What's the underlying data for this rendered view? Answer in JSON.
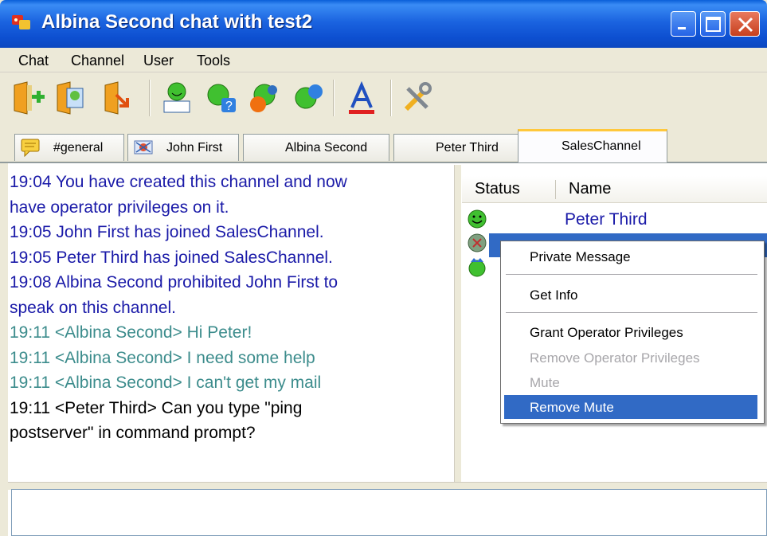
{
  "window": {
    "title": "Albina Second chat with test2",
    "title_color": "#ffffff",
    "titlebar_color": "#0d4fd0"
  },
  "menu": {
    "items": [
      "Chat",
      "Channel",
      "User",
      "Tools"
    ]
  },
  "toolbar": {
    "icons": [
      "enter-channel-icon",
      "channel-list-icon",
      "leave-channel-icon",
      "private-message-icon",
      "user-info-icon",
      "send-file-icon",
      "add-contact-icon",
      "font-icon",
      "settings-icon"
    ]
  },
  "tabs": [
    {
      "label": "#general",
      "icon": "chat-bubble-icon"
    },
    {
      "label": "John First",
      "icon": "muted-user-icon"
    },
    {
      "label": "Albina Second"
    },
    {
      "label": "Peter Third"
    },
    {
      "label": "SalesChannel",
      "active": true
    }
  ],
  "chat": {
    "lines": [
      {
        "text": "19:04 You have created this channel and now",
        "color": "blue"
      },
      {
        "text": "have operator privileges on it.",
        "color": "blue"
      },
      {
        "text": "19:05 John First has joined SalesChannel.",
        "color": "blue"
      },
      {
        "text": "19:05 Peter Third has joined SalesChannel.",
        "color": "blue"
      },
      {
        "text": "19:08 Albina Second prohibited John First to",
        "color": "blue"
      },
      {
        "text": "speak on this channel.",
        "color": "blue"
      },
      {
        "text": "19:11 <Albina Second> Hi Peter!",
        "color": "teal"
      },
      {
        "text": "19:11 <Albina Second> I need some help",
        "color": "teal"
      },
      {
        "text": "19:11 <Albina Second> I can't get my mail",
        "color": "teal"
      },
      {
        "text": "19:11 <Peter Third> Can you type \"ping",
        "color": "black"
      },
      {
        "text": "postserver\" in command prompt?",
        "color": "black"
      }
    ]
  },
  "userlist": {
    "header_status": "Status",
    "header_name": "Name",
    "users": [
      {
        "name": "Peter Third",
        "status": "online"
      },
      {
        "name": "",
        "status": "muted",
        "selected": true
      },
      {
        "name": "",
        "status": "operator"
      }
    ]
  },
  "context_menu": {
    "private_message": "Private Message",
    "get_info": "Get Info",
    "grant_operator": "Grant Operator Privileges",
    "remove_operator": "Remove Operator Privileges",
    "mute": "Mute",
    "remove_mute": "Remove Mute"
  },
  "colors": {
    "chat_blue": "#1a1aa8",
    "chat_teal": "#3c8c8c",
    "selection": "#316ac5",
    "tab_active_accent": "#ffc83c"
  }
}
